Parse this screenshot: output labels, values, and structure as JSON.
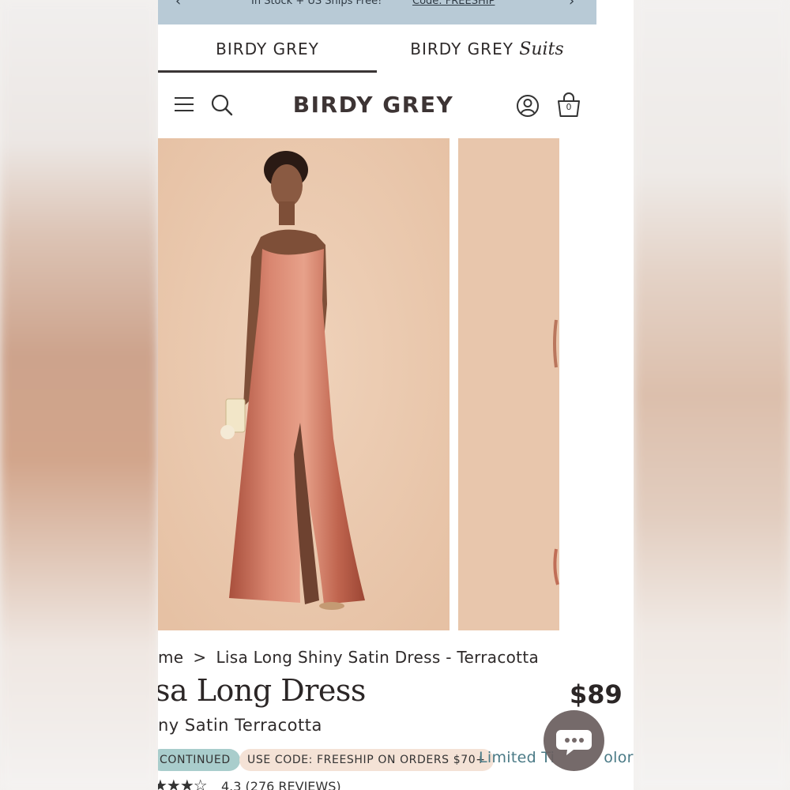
{
  "promo_bar": {
    "text": "In Stock + US Ships Free!",
    "code": "Code: FREESHIP",
    "prev_arrow": "‹",
    "next_arrow": "›"
  },
  "brand_tabs": [
    {
      "label": "BIRDY GREY",
      "active": true
    },
    {
      "label": "BIRDY GREY",
      "label_suffix": "Suits",
      "active": false
    }
  ],
  "header": {
    "logo": "BIRDY GREY",
    "cart_count": "0"
  },
  "breadcrumb": {
    "home": "me",
    "separator": ">",
    "current": "Lisa Long Shiny Satin Dress - Terracotta"
  },
  "product": {
    "title": "sa Long Dress",
    "price": "$89",
    "subtitle": "ny Satin Terracotta"
  },
  "badges": {
    "status": "CONTINUED",
    "promo": "USE CODE: FREESHIP ON ORDERS $70+",
    "limited": "Limited Ti",
    "limited_tail": "olor"
  },
  "rating": {
    "stars": 3.5,
    "text": "4.3 (276 REVIEWS)"
  },
  "colors": {
    "promo_bg": "#b8cad6",
    "photo_bg": "#eccbb0",
    "dress": "#c9705a",
    "badge_teal": "#a9cdcc",
    "badge_peach": "#f4e2d6",
    "link": "#4a7a86",
    "chat_bubble": "#6a5e5e"
  },
  "icons": {
    "menu": "hamburger-icon",
    "search": "search-icon",
    "account": "account-icon",
    "bag": "shopping-bag-icon",
    "chat": "chat-icon"
  }
}
